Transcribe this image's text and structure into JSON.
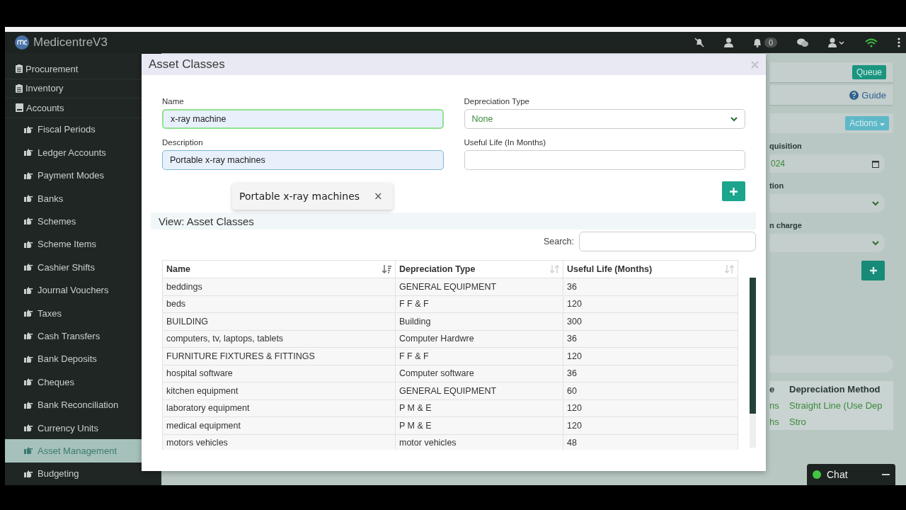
{
  "app": {
    "title": "MedicentreV3",
    "notification_count": "0"
  },
  "sidebar": {
    "items": [
      {
        "label": "Procurement",
        "expanded": false
      },
      {
        "label": "Inventory",
        "expanded": false
      },
      {
        "label": "Accounts",
        "expanded": true,
        "children": [
          {
            "label": "Fiscal Periods",
            "selected": false
          },
          {
            "label": "Ledger Accounts",
            "selected": false
          },
          {
            "label": "Payment Modes",
            "selected": false
          },
          {
            "label": "Banks",
            "selected": false
          },
          {
            "label": "Schemes",
            "selected": false
          },
          {
            "label": "Scheme Items",
            "selected": false
          },
          {
            "label": "Cashier Shifts",
            "selected": false
          },
          {
            "label": "Journal Vouchers",
            "selected": false
          },
          {
            "label": "Taxes",
            "selected": false
          },
          {
            "label": "Cash Transfers",
            "selected": false
          },
          {
            "label": "Bank Deposits",
            "selected": false
          },
          {
            "label": "Cheques",
            "selected": false
          },
          {
            "label": "Bank Reconciliation",
            "selected": false
          },
          {
            "label": "Currency Units",
            "selected": false
          },
          {
            "label": "Asset Management",
            "selected": true
          },
          {
            "label": "Budgeting",
            "selected": false
          }
        ]
      }
    ]
  },
  "background_page": {
    "queue_button": "Queue",
    "guide_link": "Guide",
    "actions_button": "Actions",
    "fields": [
      {
        "label": "quisition",
        "kind": "date",
        "value": "024"
      },
      {
        "label": "tion",
        "kind": "select"
      },
      {
        "label": "n charge",
        "kind": "select"
      }
    ],
    "table": {
      "columns": [
        "e",
        "Depreciation Method"
      ],
      "rows": [
        [
          "ns",
          "Straight Line (Use Dep"
        ],
        [
          "hs",
          "Stro"
        ]
      ]
    }
  },
  "modal": {
    "title": "Asset Classes",
    "name": {
      "label": "Name",
      "value": "x-ray machine"
    },
    "depreciation_type": {
      "label": "Depreciation Type",
      "value": "None"
    },
    "description": {
      "label": "Description",
      "value": "Portable x-ray machines"
    },
    "useful_life": {
      "label": "Useful Life (In Months)"
    },
    "suggestion": {
      "text": "Portable x-ray machines",
      "close": "×"
    },
    "view_title": "View: Asset Classes",
    "search_label": "Search:",
    "table": {
      "columns": [
        {
          "label": "Name",
          "sorted": true
        },
        {
          "label": "Depreciation Type",
          "sorted": false
        },
        {
          "label": "Useful Life (Months)",
          "sorted": false
        }
      ],
      "rows": [
        [
          "beddings",
          "GENERAL EQUIPMENT",
          "36"
        ],
        [
          "beds",
          "F F & F",
          "120"
        ],
        [
          "BUILDING",
          "Building",
          "300"
        ],
        [
          "computers, tv, laptops, tablets",
          "Computer Hardwre",
          "36"
        ],
        [
          "FURNITURE FIXTURES & FITTINGS",
          "F F & F",
          "120"
        ],
        [
          "hospital software",
          "Computer software",
          "36"
        ],
        [
          "kitchen equipment",
          "GENERAL EQUIPMENT",
          "60"
        ],
        [
          "laboratory equipment",
          "P M & E",
          "120"
        ],
        [
          "medical equipment",
          "P M & E",
          "120"
        ],
        [
          "motors vehicles",
          "motor vehicles",
          "48"
        ]
      ]
    }
  },
  "chat": {
    "label": "Chat"
  }
}
